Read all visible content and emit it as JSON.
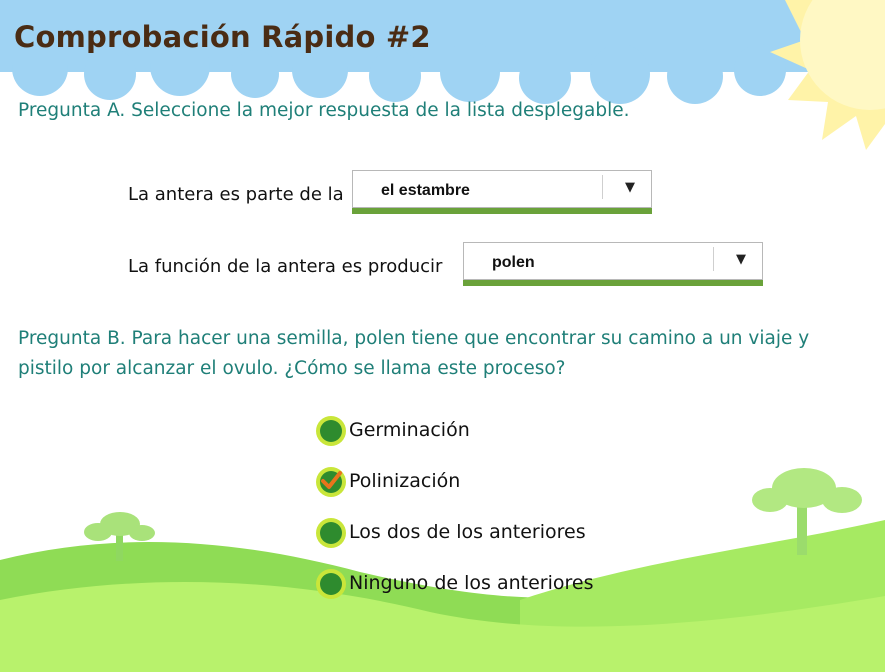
{
  "page": {
    "title": "Comprobación Rápido #2"
  },
  "question_a": {
    "text": "Pregunta A. Seleccione la mejor respuesta de la lista desplegable.",
    "items": [
      {
        "prompt": "La antera es parte de la",
        "selected": "el estambre"
      },
      {
        "prompt": "La función de la antera es producir",
        "selected": "polen"
      }
    ]
  },
  "question_b": {
    "text": "Pregunta B. Para hacer una semilla, polen tiene que encontrar su camino a un viaje y pistilo por alcanzar el ovulo. ¿Cómo se llama este proceso?",
    "options": [
      {
        "label": "Germinación",
        "checked": false
      },
      {
        "label": "Polinización",
        "checked": true
      },
      {
        "label": "Los dos de los anteriores",
        "checked": false
      },
      {
        "label": "Ninguno de los anteriores",
        "checked": false
      }
    ]
  },
  "colors": {
    "sky": "#9fd3f3",
    "sun": "#fff0a0",
    "grass_light": "#b4f06a",
    "grass_mid": "#8fdc55",
    "tree": "#a9e27a",
    "title": "#4a2c14",
    "question_text": "#1f7f78",
    "radio_green": "#2e8b2e",
    "check_orange": "#e8741c"
  }
}
